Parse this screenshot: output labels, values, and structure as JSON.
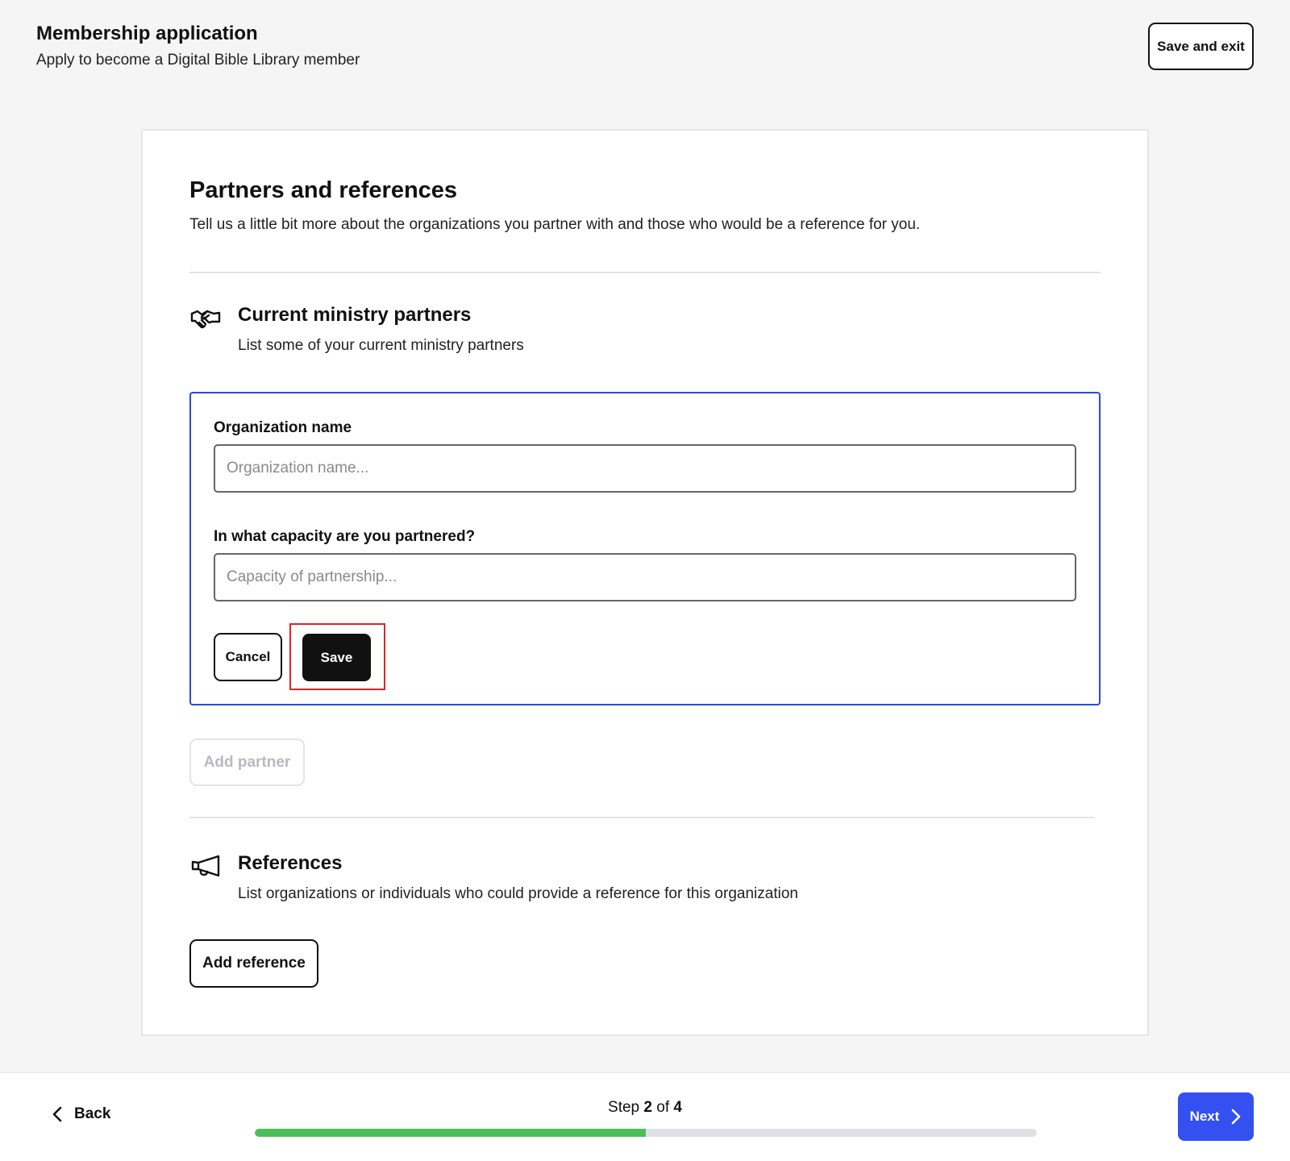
{
  "header": {
    "title": "Membership application",
    "subtitle": "Apply to become a Digital Bible Library member",
    "save_exit_label": "Save and exit"
  },
  "section": {
    "title": "Partners and references",
    "description": "Tell us a little bit more about the organizations you partner with and those who would be a reference for you."
  },
  "partners": {
    "icon": "handshake-icon",
    "title": "Current ministry partners",
    "description": "List some of your current ministry partners",
    "form": {
      "org_label": "Organization name",
      "org_placeholder": "Organization name...",
      "org_value": "",
      "capacity_label": "In what capacity are you partnered?",
      "capacity_placeholder": "Capacity of partnership...",
      "capacity_value": "",
      "cancel_label": "Cancel",
      "save_label": "Save"
    },
    "add_label": "Add partner"
  },
  "references": {
    "icon": "megaphone-icon",
    "title": "References",
    "description": "List organizations or individuals who could provide a reference for this organization",
    "add_label": "Add reference"
  },
  "footer": {
    "back_label": "Back",
    "step_prefix": "Step",
    "step_current": "2",
    "step_of": "of",
    "step_total": "4",
    "progress_fraction": 0.5,
    "next_label": "Next"
  },
  "colors": {
    "accent": "#3450f0",
    "form_border": "#2e47e0",
    "progress": "#4cbf5b",
    "highlight": "#e0232b"
  }
}
